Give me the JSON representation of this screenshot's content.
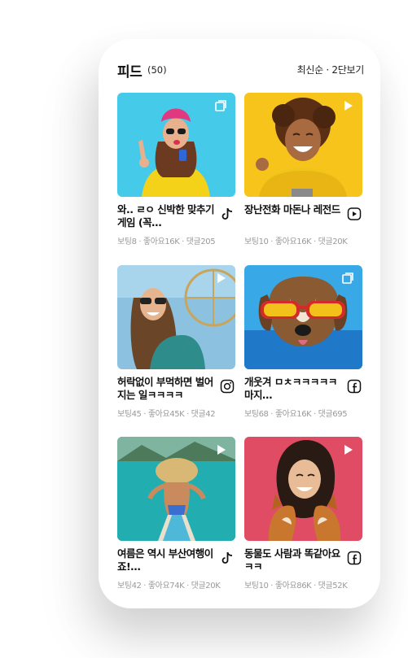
{
  "header": {
    "title": "피드",
    "count": "(50)",
    "sort": "최신순 · 2단보기"
  },
  "cards": [
    {
      "title": "와.. ㄹㅇ 신박한 맞추기 게임 (꼭…",
      "stats": "보팅8 · 좋아요16K · 댓글205",
      "platform": "tiktok-icon",
      "badge": "gallery-icon",
      "bg": "#3fc8e8"
    },
    {
      "title": "장난전화 마돈나 레전드",
      "stats": "보팅10 · 좋아요16K · 댓글20K",
      "platform": "youtube-icon",
      "badge": "play-icon",
      "bg": "#f5c518"
    },
    {
      "title": "허락없이 부먹하면 벌어지는 일ㅋㅋㅋㅋ",
      "stats": "보팅45 · 좋아요45K · 댓글42",
      "platform": "instagram-icon",
      "badge": "play-icon",
      "bg": "#7fb8d8"
    },
    {
      "title": "개웃겨 ㅁㅊㅋㅋㅋㅋㅋ마지…",
      "stats": "보팅68 · 좋아요16K · 댓글695",
      "platform": "facebook-icon",
      "badge": "gallery-icon",
      "bg": "#2aa0e0"
    },
    {
      "title": "여름은 역시 부산여행이죠!…",
      "stats": "보팅42 · 좋아요74K · 댓글20K",
      "platform": "tiktok-icon",
      "badge": "play-icon",
      "bg": "#2bb5b5"
    },
    {
      "title": "동물도 사람과 똑같아요ㅋㅋ",
      "stats": "보팅10 · 좋아요86K · 댓글52K",
      "platform": "facebook-icon",
      "badge": "play-icon",
      "bg": "#e04a62"
    }
  ]
}
